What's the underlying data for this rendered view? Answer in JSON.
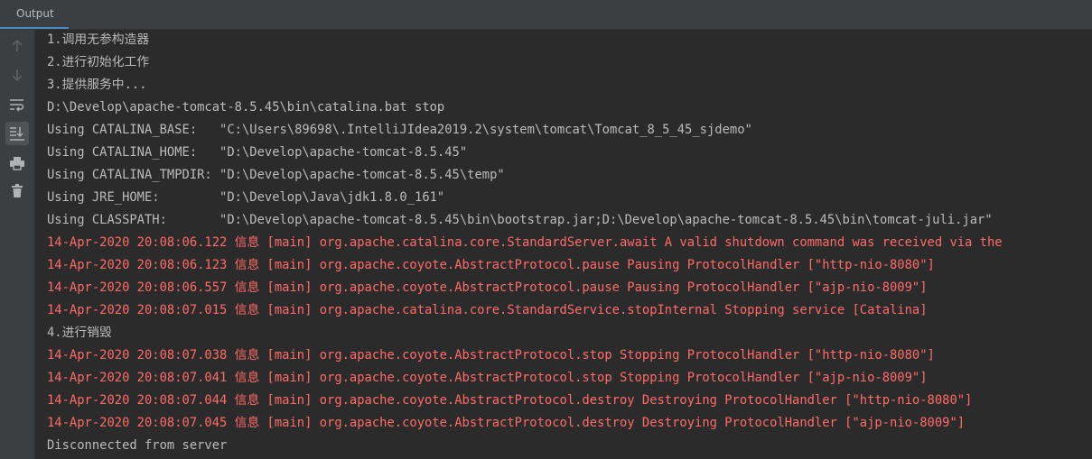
{
  "tabs": {
    "output_label": "Output"
  },
  "toolbar": {
    "icons": [
      "up-arrow-icon",
      "down-arrow-icon",
      "soft-wrap-icon",
      "scroll-to-end-icon",
      "print-icon",
      "clear-trash-icon"
    ]
  },
  "colors": {
    "background": "#2b2b2b",
    "panel": "#3c3f41",
    "normal_text": "#bbbbbb",
    "error_text": "#ff6b68",
    "tab_underline": "#4a88c7"
  },
  "console": {
    "lines": [
      {
        "text": "1.调用无参构造器",
        "kind": "normal"
      },
      {
        "text": "2.进行初始化工作",
        "kind": "normal"
      },
      {
        "text": "3.提供服务中...",
        "kind": "normal"
      },
      {
        "text": "D:\\Develop\\apache-tomcat-8.5.45\\bin\\catalina.bat stop",
        "kind": "normal"
      },
      {
        "text": "Using CATALINA_BASE:   \"C:\\Users\\89698\\.IntelliJIdea2019.2\\system\\tomcat\\Tomcat_8_5_45_sjdemo\"",
        "kind": "normal"
      },
      {
        "text": "Using CATALINA_HOME:   \"D:\\Develop\\apache-tomcat-8.5.45\"",
        "kind": "normal"
      },
      {
        "text": "Using CATALINA_TMPDIR: \"D:\\Develop\\apache-tomcat-8.5.45\\temp\"",
        "kind": "normal"
      },
      {
        "text": "Using JRE_HOME:        \"D:\\Develop\\Java\\jdk1.8.0_161\"",
        "kind": "normal"
      },
      {
        "text": "Using CLASSPATH:       \"D:\\Develop\\apache-tomcat-8.5.45\\bin\\bootstrap.jar;D:\\Develop\\apache-tomcat-8.5.45\\bin\\tomcat-juli.jar\"",
        "kind": "normal"
      },
      {
        "text": "14-Apr-2020 20:08:06.122 信息 [main] org.apache.catalina.core.StandardServer.await A valid shutdown command was received via the",
        "kind": "error"
      },
      {
        "text": "14-Apr-2020 20:08:06.123 信息 [main] org.apache.coyote.AbstractProtocol.pause Pausing ProtocolHandler [\"http-nio-8080\"]",
        "kind": "error"
      },
      {
        "text": "14-Apr-2020 20:08:06.557 信息 [main] org.apache.coyote.AbstractProtocol.pause Pausing ProtocolHandler [\"ajp-nio-8009\"]",
        "kind": "error"
      },
      {
        "text": "14-Apr-2020 20:08:07.015 信息 [main] org.apache.catalina.core.StandardService.stopInternal Stopping service [Catalina]",
        "kind": "error"
      },
      {
        "text": "4.进行销毁",
        "kind": "normal"
      },
      {
        "text": "14-Apr-2020 20:08:07.038 信息 [main] org.apache.coyote.AbstractProtocol.stop Stopping ProtocolHandler [\"http-nio-8080\"]",
        "kind": "error"
      },
      {
        "text": "14-Apr-2020 20:08:07.041 信息 [main] org.apache.coyote.AbstractProtocol.stop Stopping ProtocolHandler [\"ajp-nio-8009\"]",
        "kind": "error"
      },
      {
        "text": "14-Apr-2020 20:08:07.044 信息 [main] org.apache.coyote.AbstractProtocol.destroy Destroying ProtocolHandler [\"http-nio-8080\"]",
        "kind": "error"
      },
      {
        "text": "14-Apr-2020 20:08:07.045 信息 [main] org.apache.coyote.AbstractProtocol.destroy Destroying ProtocolHandler [\"ajp-nio-8009\"]",
        "kind": "error"
      },
      {
        "text": "Disconnected from server",
        "kind": "normal"
      }
    ]
  }
}
